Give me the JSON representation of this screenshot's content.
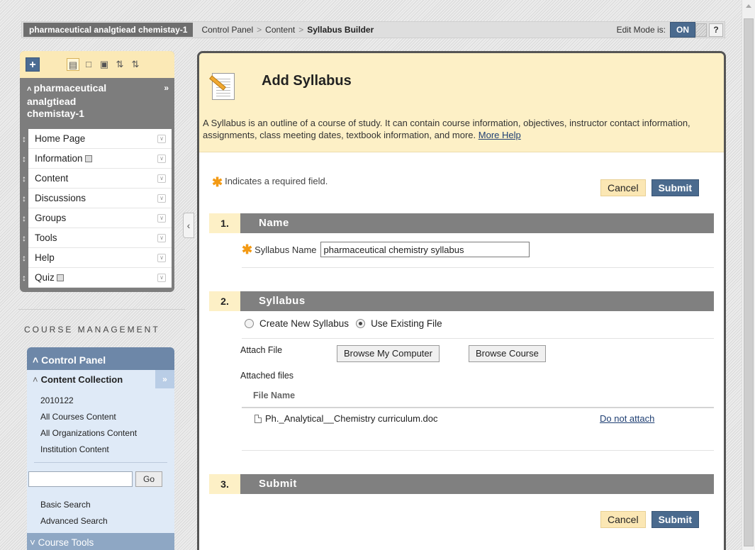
{
  "topbar": {
    "course": "pharmaceutical analgtiead chemistay-1",
    "crumbs": [
      "Control Panel",
      "Content",
      "Syllabus Builder"
    ],
    "crumb_sep": ">",
    "edit_mode_label": "Edit Mode is:",
    "edit_mode_value": "ON",
    "help_label": "?"
  },
  "course_menu": {
    "add_label": "+",
    "title": "pharmaceutical analgtiead chemistay-1",
    "title_line1": "pharmaceutical",
    "title_line2": "analgtiead",
    "title_line3": "chemistay-1",
    "items": [
      {
        "label": "Home Page"
      },
      {
        "label": "Information"
      },
      {
        "label": "Content"
      },
      {
        "label": "Discussions"
      },
      {
        "label": "Groups"
      },
      {
        "label": "Tools"
      },
      {
        "label": "Help"
      },
      {
        "label": "Quiz"
      }
    ]
  },
  "course_management": {
    "heading": "COURSE MANAGEMENT",
    "control_panel": "Control Panel",
    "content_collection": "Content Collection",
    "collection_links": [
      "2010122",
      "All Courses Content",
      "All Organizations Content",
      "Institution Content"
    ],
    "search_value": "",
    "go_label": "Go",
    "search_links": [
      "Basic Search",
      "Advanced Search"
    ],
    "course_tools": "Course Tools"
  },
  "main": {
    "title": "Add Syllabus",
    "description": "A Syllabus is an outline of a course of study. It can contain course information, objectives, instructor contact information, assignments, class meeting dates, textbook information, and more.",
    "more_help": "More Help",
    "required_note": "Indicates a required field.",
    "cancel_label": "Cancel",
    "submit_label": "Submit",
    "steps": [
      {
        "number": "1.",
        "title": "Name"
      },
      {
        "number": "2.",
        "title": "Syllabus"
      },
      {
        "number": "3.",
        "title": "Submit"
      }
    ],
    "syllabus_name_label": "Syllabus Name",
    "syllabus_name_value": "pharmaceutical chemistry syllabus",
    "radio_create": "Create New Syllabus",
    "radio_existing": "Use Existing File",
    "selected_option": "Use Existing File",
    "attach_file_label": "Attach File",
    "browse_computer": "Browse My Computer",
    "browse_course": "Browse Course",
    "attached_files_label": "Attached files",
    "file_name_header": "File Name",
    "file_name": "Ph._Analytical__Chemistry curriculum.doc",
    "do_not_attach": "Do not attach"
  },
  "colors": {
    "accent_blue": "#4a6a8e",
    "header_yellow": "#fdf0c6",
    "step_gray": "#808080",
    "required_star": "#f39a14"
  }
}
